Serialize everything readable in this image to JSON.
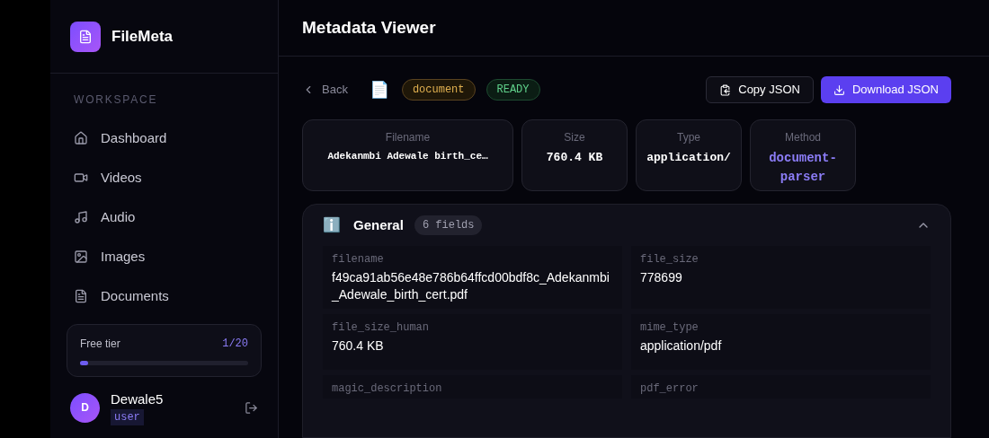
{
  "brand": {
    "name": "FileMeta"
  },
  "sidebar": {
    "section": "WORKSPACE",
    "items": [
      {
        "label": "Dashboard",
        "kind": "home"
      },
      {
        "label": "Videos",
        "kind": "video"
      },
      {
        "label": "Audio",
        "kind": "music"
      },
      {
        "label": "Images",
        "kind": "image"
      },
      {
        "label": "Documents",
        "kind": "document"
      }
    ]
  },
  "usage": {
    "label": "Free tier",
    "count": "1/20",
    "level": 0.05
  },
  "user": {
    "initial": "D",
    "name": "Dewale5",
    "role": "user"
  },
  "header": {
    "title": "Metadata Viewer"
  },
  "toolbar": {
    "back": "Back",
    "file_icon": "📄",
    "type_tag": "document",
    "status": "READY",
    "copy": "Copy JSON",
    "download": "Download JSON"
  },
  "summary": [
    {
      "label": "Filename",
      "value": "Adekanmbi Adewale birth_ce…",
      "kind": "plain"
    },
    {
      "label": "Size",
      "value": "760.4 KB",
      "kind": "plain"
    },
    {
      "label": "Type",
      "value": "application/",
      "kind": "plain"
    },
    {
      "label": "Method",
      "value": "document-parser",
      "kind": "accent"
    }
  ],
  "section": {
    "icon": "ℹ️",
    "title": "General",
    "count": "6 fields",
    "expanded": true,
    "fields": [
      {
        "key": "filename",
        "value": "f49ca91ab56e48e786b64ffcd00bdf8c_Adekanmbi_Adewale_birth_cert.pdf"
      },
      {
        "key": "file_size",
        "value": "778699"
      },
      {
        "key": "file_size_human",
        "value": "760.4 KB"
      },
      {
        "key": "mime_type",
        "value": "application/pdf"
      },
      {
        "key": "magic_description"
      },
      {
        "key": "pdf_error"
      }
    ]
  }
}
